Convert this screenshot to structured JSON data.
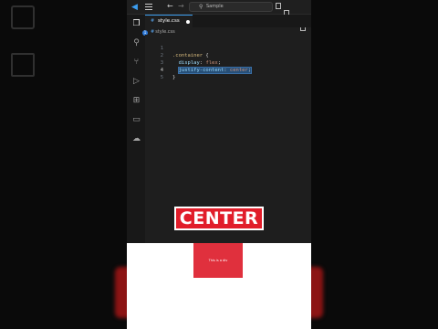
{
  "titlebar": {
    "search_text": "Sample"
  },
  "activity_bar": {
    "items": [
      "explorer-icon",
      "search-icon",
      "source-control-icon",
      "run-debug-icon",
      "extensions-icon",
      "remote-explorer-icon",
      "docker-icon"
    ],
    "badge": "1"
  },
  "tab": {
    "label": "style.css"
  },
  "breadcrumb": {
    "file": "style.css"
  },
  "code_lines": [
    {
      "num": "1",
      "selector": ".container",
      "brace": " {"
    },
    {
      "num": "2",
      "prop": "display",
      "sep": ": ",
      "val": "flex",
      "end": ";"
    },
    {
      "num": "3",
      "prop": "justify-content",
      "sep": ": ",
      "val": "center",
      "end": ";"
    },
    {
      "num": "4",
      "close": "}"
    },
    {
      "num": "5"
    }
  ],
  "caption": "CENTER",
  "preview": {
    "box_text": "This is a div"
  },
  "colors": {
    "accent": "#3b9df0",
    "caption_bg": "#e11d2a",
    "preview_box": "#e0303d"
  }
}
